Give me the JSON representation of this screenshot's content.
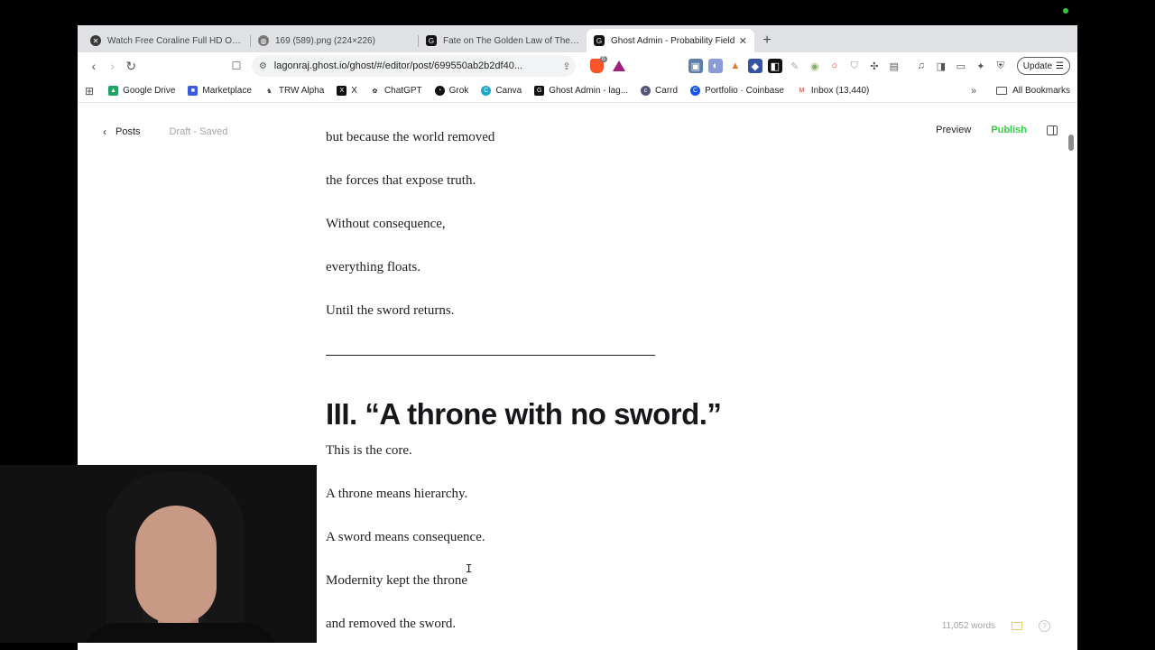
{
  "tabs": [
    {
      "title": "Watch Free Coraline Full HD Online",
      "icon": "x-circle-icon"
    },
    {
      "title": "169 (589).png (224×226)",
      "icon": "globe-icon"
    },
    {
      "title": "Fate on The Golden Law of The Un",
      "icon": "ghost-icon"
    },
    {
      "title": "Ghost Admin - Probability Field",
      "icon": "ghost-icon",
      "active": true
    }
  ],
  "toolbar": {
    "url": "lagonraj.ghost.io/ghost/#/editor/post/699550ab2b2df40...",
    "brave_badge": "6",
    "update_label": "Update"
  },
  "bookmarks": [
    {
      "label": "Google Drive",
      "color": "#1fa463"
    },
    {
      "label": "Marketplace",
      "color": "#3b5bdb"
    },
    {
      "label": "TRW Alpha",
      "color": "#444444"
    },
    {
      "label": "X",
      "color": "#111111"
    },
    {
      "label": "ChatGPT",
      "color": "#222222"
    },
    {
      "label": "Grok",
      "color": "#111111"
    },
    {
      "label": "Canva",
      "color": "#19a7c9"
    },
    {
      "label": "Ghost Admin - lag...",
      "color": "#111111"
    },
    {
      "label": "Carrd",
      "color": "#555577"
    },
    {
      "label": "Portfolio · Coinbase",
      "color": "#1652f0"
    },
    {
      "label": "Inbox (13,440)",
      "color": "#d93025"
    }
  ],
  "bookmarks_right": {
    "all_bookmarks": "All Bookmarks"
  },
  "ghost": {
    "posts_label": "Posts",
    "status": "Draft - Saved",
    "preview_label": "Preview",
    "publish_label": "Publish",
    "word_count": "11,052 words"
  },
  "article": {
    "paragraphs_top": [
      "but because the world removed",
      "the forces that expose truth.",
      "Without consequence,",
      "everything floats.",
      "Until the sword returns."
    ],
    "heading": "III. “A throne with no sword.”",
    "paragraphs_bottom": [
      "This is the core.",
      "A throne means hierarchy.",
      "A sword means consequence.",
      "Modernity kept the throne",
      "and removed the sword."
    ]
  }
}
